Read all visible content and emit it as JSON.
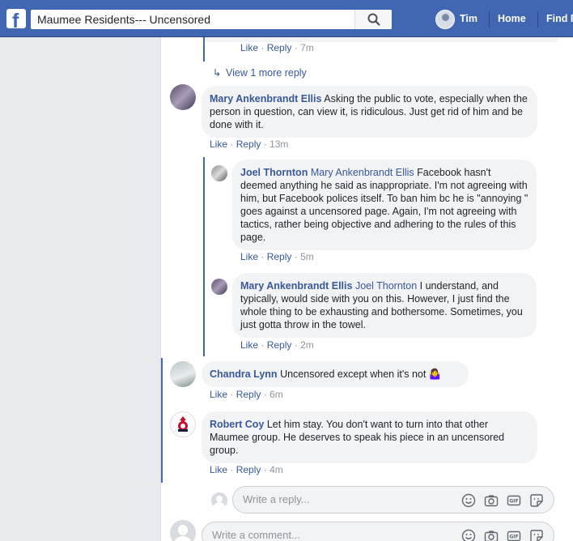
{
  "search": {
    "value": "Maumee Residents--- Uncensored"
  },
  "nav": {
    "user_name": "Tim",
    "home_label": "Home",
    "find_friends_label": "Find F"
  },
  "thread_top": {
    "like": "Like",
    "reply": "Reply",
    "time": "7m",
    "view_more": "View 1 more reply"
  },
  "comments": [
    {
      "author": "Mary Ankenbrandt Ellis",
      "tag": "",
      "text": "Asking the public to vote, especially when the person in question, can view it, is ridiculous. Just get rid of him and be done with it.",
      "like": "Like",
      "reply": "Reply",
      "time": "13m"
    },
    {
      "author": "Joel Thornton",
      "tag": "Mary Ankenbrandt Ellis",
      "text": "Facebook hasn't deemed anything he said as inappropriate. I'm not agreeing with him, but Facebook polices itself. To ban him bc he is \"annoying \" goes against a uncensored page. Again, I'm not agreeing with tactics, rather being objective and adhering to the rules of this page.",
      "like": "Like",
      "reply": "Reply",
      "time": "5m"
    },
    {
      "author": "Mary Ankenbrandt Ellis",
      "tag": "Joel Thornton",
      "text": "I understand, and typically, would side with you on this. However, I just find the whole thing to be exhausting and bothersome. Sometimes, you just gotta throw in the towel.",
      "like": "Like",
      "reply": "Reply",
      "time": "2m"
    },
    {
      "author": "Chandra Lynn",
      "tag": "",
      "text": "Uncensored except when it's not",
      "emoji": "🤷‍♀️",
      "like": "Like",
      "reply": "Reply",
      "time": "6m"
    },
    {
      "author": "Robert Coy",
      "tag": "",
      "text": "Let him stay. You don't want to turn into that other Maumee group. He deserves to speak his piece in an uncensored group.",
      "like": "Like",
      "reply": "Reply",
      "time": "4m"
    }
  ],
  "reply_box": {
    "placeholder": "Write a reply..."
  },
  "comment_box": {
    "placeholder": "Write a comment..."
  },
  "colors": {
    "brand": "#4267b2",
    "link": "#385898",
    "bubble": "#f2f3f5"
  }
}
